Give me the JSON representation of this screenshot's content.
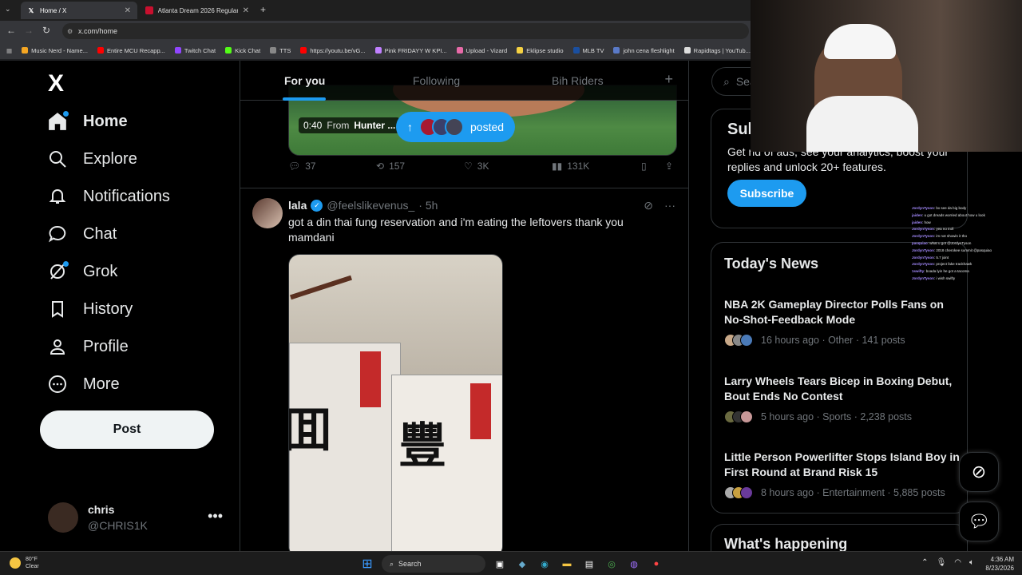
{
  "browser": {
    "tabs": [
      {
        "title": "Home / X",
        "active": true
      },
      {
        "title": "Atlanta Dream 2026 Regular Se",
        "active": false
      }
    ],
    "new_tab": "+",
    "url": "x.com/home",
    "bookmarks": [
      "Music Nerd - Name...",
      "Entire MCU Recapp...",
      "Twitch Chat",
      "Kick Chat",
      "TTS",
      "https://youtu.be/vG...",
      "Pink FRIDAYY W KPI...",
      "Upload - Vizard",
      "Eklipse studio",
      "MLB TV",
      "john cena fleshlight",
      "Rapidtags | YouTub..."
    ]
  },
  "sidebar": {
    "logo": "X",
    "items": [
      {
        "label": "Home",
        "icon": "home-icon"
      },
      {
        "label": "Explore",
        "icon": "search-icon"
      },
      {
        "label": "Notifications",
        "icon": "bell-icon"
      },
      {
        "label": "Chat",
        "icon": "chat-icon"
      },
      {
        "label": "Grok",
        "icon": "grok-icon"
      },
      {
        "label": "History",
        "icon": "bookmark-icon"
      },
      {
        "label": "Profile",
        "icon": "person-icon"
      },
      {
        "label": "More",
        "icon": "more-circle-icon"
      }
    ],
    "post_label": "Post",
    "account": {
      "name": "chris",
      "handle": "@CHRIS1K"
    }
  },
  "feed": {
    "tabs": [
      "For you",
      "Following",
      "Bih Riders"
    ],
    "video": {
      "time": "0:40",
      "from": "From",
      "by": "Hunter ..."
    },
    "posted_pill": "posted",
    "prev_actions": {
      "replies": "37",
      "reposts": "157",
      "likes": "3K",
      "views": "131K"
    },
    "tweet": {
      "name": "lala",
      "handle": "@feelslikevenus_",
      "time": "· 5h",
      "text": "got a din thai fung reservation and i'm eating the leftovers thank you mamdani"
    }
  },
  "right": {
    "search_placeholder": "Sea",
    "subscribe": {
      "title": "Sub",
      "text": "Get rid of ads, see your analytics, boost your replies and unlock 20+ features.",
      "button": "Subscribe"
    },
    "news_title": "Today's News",
    "news": [
      {
        "title": "NBA 2K Gameplay Director Polls Fans on No-Shot-Feedback Mode",
        "meta": "16 hours ago · Other · 141 posts"
      },
      {
        "title": "Larry Wheels Tears Bicep in Boxing Debut, Bout Ends No Contest",
        "meta": "5 hours ago · Sports · 2,238 posts"
      },
      {
        "title": "Little Person Powerlifter Stops Island Boy in First Round at Brand Risk 15",
        "meta": "8 hours ago · Entertainment · 5,885 posts"
      }
    ],
    "happening": "What's happening"
  },
  "stream_chat": [
    {
      "user": "JordynTyson",
      "msg": ": bx see da big body"
    },
    {
      "user": "jaiden",
      "msg": ": u got dreads worried about how u look"
    },
    {
      "user": "jaiden",
      "msg": ": how"
    },
    {
      "user": "JordynTyson",
      "msg": ": yea no troll"
    },
    {
      "user": "JordynTyson",
      "msg": ": im not showin it tho"
    },
    {
      "user": "pasquiao",
      "msg": ": what u got @JordynTyson"
    },
    {
      "user": "JordynTyson",
      "msg": ": 2018 cherokee summit @pasquiao"
    },
    {
      "user": "JordynTyson",
      "msg": ": 5.7 joint"
    },
    {
      "user": "JordynTyson",
      "msg": ": project fake trackhawk"
    },
    {
      "user": "1swifty",
      "msg": ": boada lyin he got a tacoma"
    },
    {
      "user": "JordynTyson",
      "msg": ": i wish swifty"
    }
  ],
  "taskbar": {
    "temp": "80°F",
    "cond": "Clear",
    "search": "Search",
    "time": "4:36 AM",
    "date": "8/23/2026"
  }
}
